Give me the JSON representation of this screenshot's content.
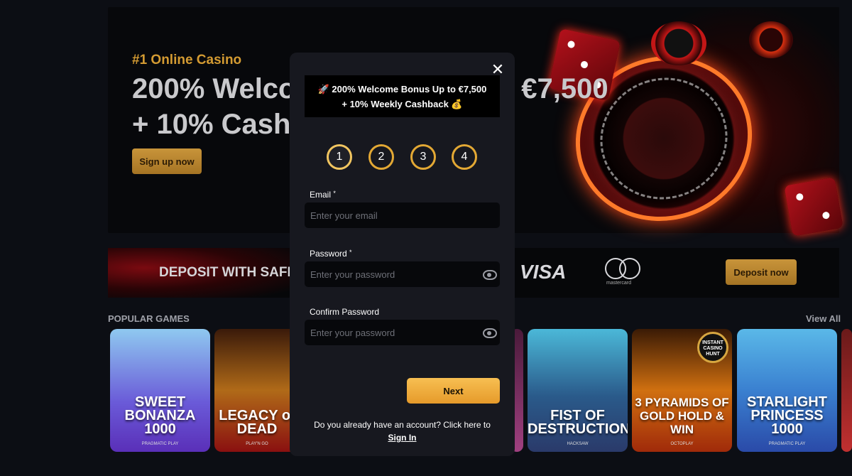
{
  "hero": {
    "kicker": "#1 Online Casino",
    "title_line1": "200% Welcome Bonus Up to €7,500",
    "title_line2": "+ 10% Cashback",
    "visible_amount": "7,500",
    "cta": "Sign up now"
  },
  "deposit_banner": {
    "text": "DEPOSIT WITH SAFE",
    "visa": "VISA",
    "mastercard": "mastercard",
    "cta": "Deposit now"
  },
  "games": {
    "section_title": "POPULAR GAMES",
    "view_all": "View All",
    "items": [
      {
        "name": "SWEET BONANZA 1000",
        "provider": "PRAGMATIC PLAY"
      },
      {
        "name": "LEGACY of DEAD",
        "provider": "PLAY'N GO"
      },
      {
        "name": "",
        "provider": ""
      },
      {
        "name": "FIST OF DESTRUCTION",
        "provider": "HACKSAW"
      },
      {
        "name": "3 PYRAMIDS OF GOLD HOLD & WIN",
        "provider": "OCTOPLAY",
        "badge": "INSTANT CASINO HUNT"
      },
      {
        "name": "STARLIGHT PRINCESS 1000",
        "provider": "PRAGMATIC PLAY"
      },
      {
        "name": "",
        "provider": ""
      }
    ]
  },
  "modal": {
    "close_symbol": "✕",
    "banner_line1": "🚀 200% Welcome Bonus Up to €7,500",
    "banner_line2": "+ 10% Weekly Cashback 💰",
    "steps": [
      "1",
      "2",
      "3",
      "4"
    ],
    "active_step": 1,
    "email": {
      "label": "Email",
      "required": "*",
      "placeholder": "Enter your email",
      "value": ""
    },
    "password": {
      "label": "Password",
      "required": "*",
      "placeholder": "Enter your password",
      "value": ""
    },
    "confirm_password": {
      "label": "Confirm Password",
      "placeholder": "Enter your password",
      "value": ""
    },
    "next_label": "Next",
    "footer_text": "Do you already have an account? Click here to",
    "signin_label": "Sign In"
  },
  "colors": {
    "accent_gold": "#e3a834",
    "button_gold": "#f7bf52",
    "modal_bg": "#17181f",
    "page_bg": "#0c0e14"
  }
}
